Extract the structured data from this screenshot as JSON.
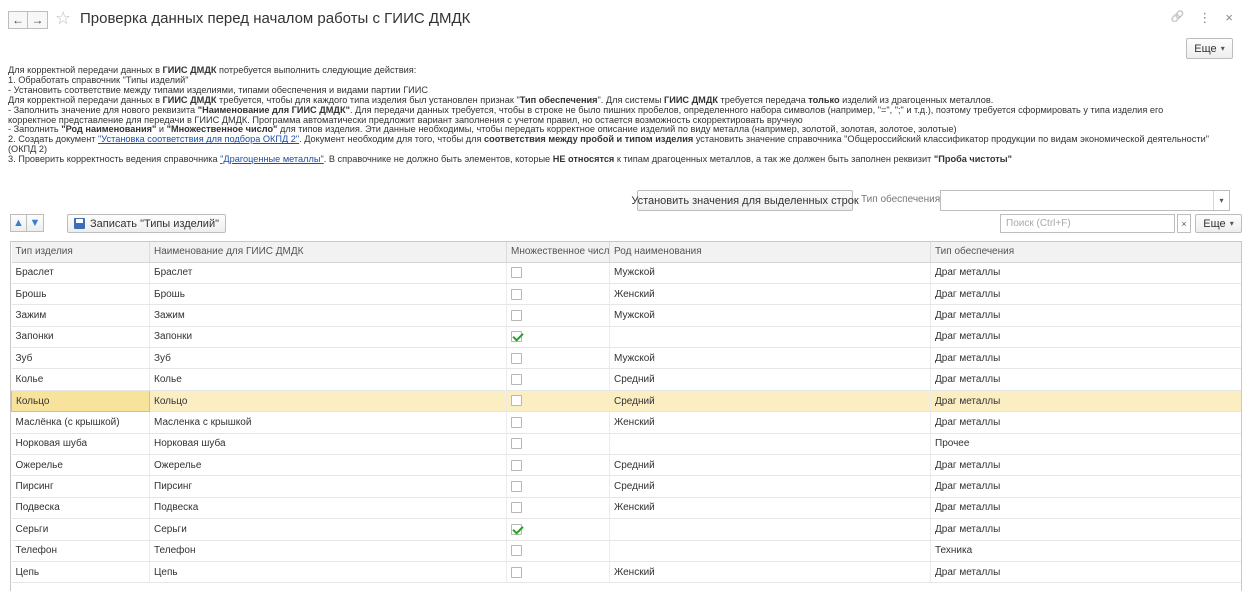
{
  "window": {
    "title": "Проверка данных перед началом работы с ГИИС ДМДК",
    "back_symbol": "←",
    "forward_symbol": "→",
    "star_symbol": "☆",
    "link_symbol": "🔗",
    "menu_symbol": "⋮",
    "close_symbol": "×"
  },
  "top": {
    "more_label": "Еще"
  },
  "instructions": {
    "l1a": "Для корректной передачи данных в ",
    "l1b": "ГИИС ДМДК",
    "l1c": " потребуется выполнить следующие действия:",
    "l2": "1. Обработать справочник \"Типы изделий\"",
    "l3": "- Установить соответствие между типами изделиями, типами обеспечения и видами партии ГИИС",
    "l4a": "Для корректной передачи данных в ",
    "l4b": "ГИИС ДМДК",
    "l4c": " требуется, чтобы для каждого типа изделия был установлен признак \"",
    "l4d": "Тип обеспечения",
    "l4e": "\". Для системы ",
    "l4f": "ГИИС ДМДК",
    "l4g": " требуется передача ",
    "l4h": "только",
    "l4i": " изделий из драгоценных металлов.",
    "l5a": "- Заполнить значение для нового реквизита ",
    "l5b": "\"Наименование для ГИИС ДМДК\"",
    "l5c": ". Для передачи данных требуется, чтобы в строке не было пишних пробелов, определенного набора символов (например, \"=\", \";\" и т.д.), поэтому требуется сформировать у типа изделия его",
    "l6": "корректное представление для передачи в ГИИС ДМДК. Программа автоматически предложит вариант заполнения с учетом правил, но остается возможность скорректировать вручную",
    "l7a": "- Заполнить ",
    "l7b": "\"Род наименования\"",
    "l7c": " и ",
    "l7d": "\"Множественное число\"",
    "l7e": " для типов изделия. Эти данные необходимы, чтобы передать корректное описание изделий по виду металла (например, золотой, золотая, золотое, золотые)",
    "l8a": "2. Создать документ ",
    "l8b": "\"Установка соответствия для подбора ОКПД 2\"",
    "l8c": ". Документ необходим для того, чтобы для ",
    "l8d": "соответствия между пробой и типом изделия",
    "l8e": " установить значение справочника \"Общероссийский классификатор продукции по видам экономической деятельности\" (ОКПД 2)",
    "l9a": "3. Проверить корректность ведения справочника ",
    "l9b": "\"Драгоценные металлы\"",
    "l9c": ". В справочнике не должно быть элементов, которые ",
    "l9d": "НЕ относятся",
    "l9e": " к типам драгоценных металлов, а так же должен быть заполнен реквизит ",
    "l9f": "\"Проба чистоты\""
  },
  "controls": {
    "set_values_label": "Установить значения для выделенных строк",
    "supply_label": "Тип обеспечения:",
    "supply_value": ""
  },
  "toolbar": {
    "up_symbol": "🡅",
    "down_symbol": "🡇",
    "save_label": "Записать \"Типы изделий\"",
    "search_placeholder": "Поиск (Ctrl+F)",
    "clear_symbol": "×",
    "more_label": "Еще"
  },
  "table": {
    "headers": [
      "Тип изделия",
      "Наименование для ГИИС ДМДК",
      "Множественное число",
      "Род наименования",
      "Тип обеспечения"
    ],
    "rows": [
      {
        "type": "Браслет",
        "name": "Браслет",
        "plural": false,
        "gender": "Мужской",
        "supply": "Драг металлы"
      },
      {
        "type": "Брошь",
        "name": "Брошь",
        "plural": false,
        "gender": "Женский",
        "supply": "Драг металлы"
      },
      {
        "type": "Зажим",
        "name": "Зажим",
        "plural": false,
        "gender": "Мужской",
        "supply": "Драг металлы"
      },
      {
        "type": "Запонки",
        "name": "Запонки",
        "plural": true,
        "gender": "",
        "supply": "Драг металлы"
      },
      {
        "type": "Зуб",
        "name": "Зуб",
        "plural": false,
        "gender": "Мужской",
        "supply": "Драг металлы"
      },
      {
        "type": "Колье",
        "name": "Колье",
        "plural": false,
        "gender": "Средний",
        "supply": "Драг металлы"
      },
      {
        "type": "Кольцо",
        "name": "Кольцо",
        "plural": false,
        "gender": "Средний",
        "supply": "Драг металлы",
        "selected": true
      },
      {
        "type": "Маслёнка (с крышкой)",
        "name": "Масленка с крышкой",
        "plural": false,
        "gender": "Женский",
        "supply": "Драг металлы"
      },
      {
        "type": "Норковая шуба",
        "name": "Норковая шуба",
        "plural": false,
        "gender": "",
        "supply": "Прочее"
      },
      {
        "type": "Ожерелье",
        "name": "Ожерелье",
        "plural": false,
        "gender": "Средний",
        "supply": "Драг металлы"
      },
      {
        "type": "Пирсинг",
        "name": "Пирсинг",
        "plural": false,
        "gender": "Средний",
        "supply": "Драг металлы"
      },
      {
        "type": "Подвеска",
        "name": "Подвеска",
        "plural": false,
        "gender": "Женский",
        "supply": "Драг металлы"
      },
      {
        "type": "Серьги",
        "name": "Серьги",
        "plural": true,
        "gender": "",
        "supply": "Драг металлы"
      },
      {
        "type": "Телефон",
        "name": "Телефон",
        "plural": false,
        "gender": "",
        "supply": "Техника"
      },
      {
        "type": "Цепь",
        "name": "Цепь",
        "plural": false,
        "gender": "Женский",
        "supply": "Драг металлы"
      }
    ]
  }
}
